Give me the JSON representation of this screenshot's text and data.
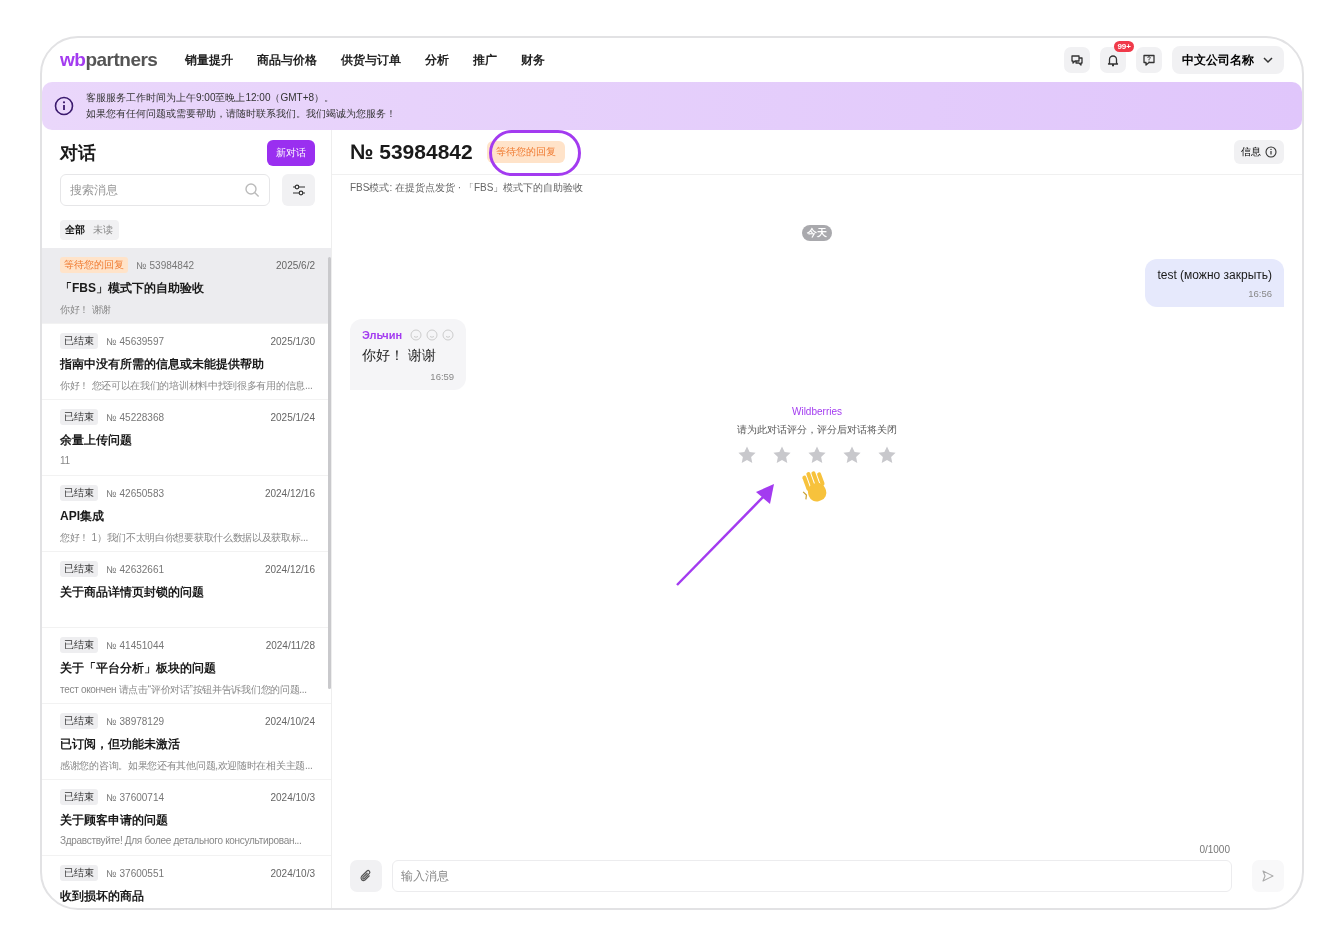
{
  "logo": {
    "prefix": "wb",
    "suffix": "partners"
  },
  "nav": [
    {
      "label": "销量提升"
    },
    {
      "label": "商品与价格"
    },
    {
      "label": "供货与订单"
    },
    {
      "label": "分析"
    },
    {
      "label": "推广"
    },
    {
      "label": "财务"
    }
  ],
  "header_actions": {
    "notification_badge": "99+",
    "company": "中文公司名称"
  },
  "banner": {
    "lines": [
      "客服服务工作时间为上午9:00至晚上12:00（GMT+8）。",
      "如果您有任何问题或需要帮助，请随时联系我们。我们竭诚为您服务！"
    ]
  },
  "sidebar": {
    "title": "对话",
    "new_button": "新对话",
    "search": {
      "placeholder": "搜索消息"
    },
    "filters": [
      {
        "label": "全部",
        "selected": true
      },
      {
        "label": "未读",
        "selected": false
      }
    ],
    "conversations": [
      {
        "status": {
          "kind": "awaiting",
          "label": "等待您的回复"
        },
        "number": "№ 53984842",
        "date": "2025/6/2",
        "title": "「FBS」模式下的自助验收",
        "preview": "你好！ 谢谢",
        "selected": true
      },
      {
        "status": {
          "kind": "closed",
          "label": "已结束"
        },
        "number": "№ 45639597",
        "date": "2025/1/30",
        "title": "指南中没有所需的信息或未能提供帮助",
        "preview": "你好！ 您还可以在我们的培训材料中找到很多有用的信息...",
        "selected": false
      },
      {
        "status": {
          "kind": "closed",
          "label": "已结束"
        },
        "number": "№ 45228368",
        "date": "2025/1/24",
        "title": "余量上传问题",
        "preview": "11",
        "selected": false
      },
      {
        "status": {
          "kind": "closed",
          "label": "已结束"
        },
        "number": "№ 42650583",
        "date": "2024/12/16",
        "title": "API集成",
        "preview": "您好！ 1）我们不太明白你想要获取什么数据以及获取标...",
        "selected": false
      },
      {
        "status": {
          "kind": "closed",
          "label": "已结束"
        },
        "number": "№ 42632661",
        "date": "2024/12/16",
        "title": "关于商品详情页封锁的问题",
        "selected": false
      },
      {
        "status": {
          "kind": "closed",
          "label": "已结束"
        },
        "number": "№ 41451044",
        "date": "2024/11/28",
        "title": "关于「平台分析」板块的问题",
        "preview": "тест окончен 请点击“评价对话”按钮并告诉我们您的问题...",
        "selected": false
      },
      {
        "status": {
          "kind": "closed",
          "label": "已结束"
        },
        "number": "№ 38978129",
        "date": "2024/10/24",
        "title": "已订阅，但功能未激活",
        "preview": "感谢您的咨询。如果您还有其他问题,欢迎随时在相关主题...",
        "selected": false
      },
      {
        "status": {
          "kind": "closed",
          "label": "已结束"
        },
        "number": "№ 37600714",
        "date": "2024/10/3",
        "title": "关于顾客申请的问题",
        "preview": "Здравствуйте! Для более детального консультирован...",
        "selected": false
      },
      {
        "status": {
          "kind": "closed",
          "label": "已结束"
        },
        "number": "№ 37600551",
        "date": "2024/10/3",
        "title": "收到损坏的商品",
        "selected": false
      }
    ]
  },
  "chat": {
    "number": "№ 53984842",
    "status": {
      "kind": "awaiting",
      "label": "等待您的回复"
    },
    "info_button": "信息",
    "subtitle": "FBS模式: 在提货点发货 · 「FBS」模式下的自助验收",
    "date_divider": "今天",
    "messages": [
      {
        "kind": "outgoing",
        "text": "test (можно закрыть)",
        "time": "16:56"
      },
      {
        "kind": "incoming",
        "sender": "Эльчин",
        "text": "你好！ 谢谢",
        "time": "16:59"
      }
    ],
    "rating": {
      "from": "Wildberries",
      "prompt": "请为此对话评分，评分后对话将关闭",
      "stars": 0
    }
  },
  "composer": {
    "counter": "0/1000",
    "placeholder": "输入消息"
  }
}
